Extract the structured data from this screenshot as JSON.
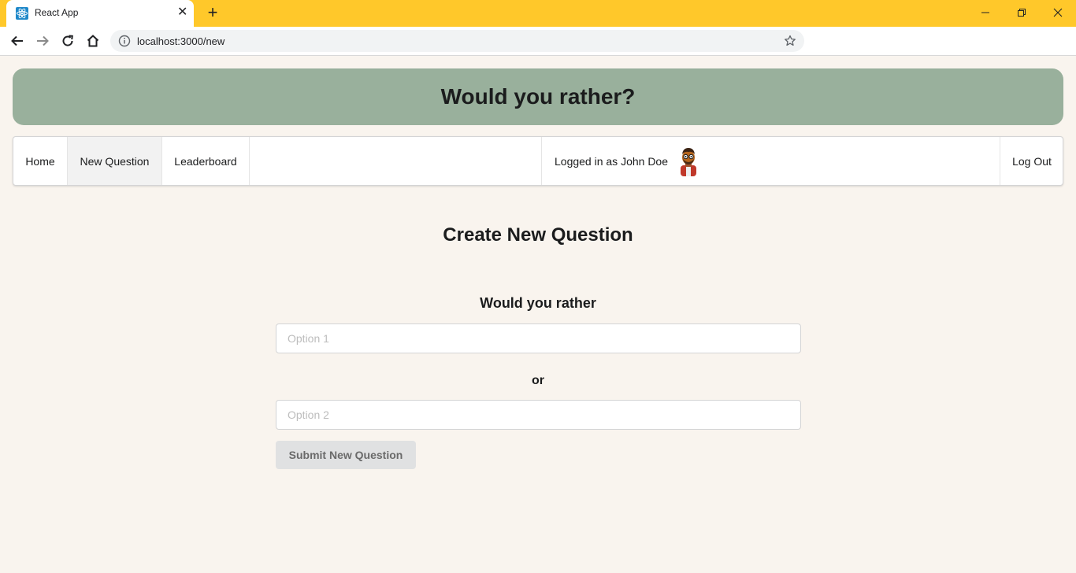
{
  "browser": {
    "tab_title": "React App",
    "url": "localhost:3000/new"
  },
  "app": {
    "title": "Would you rather?"
  },
  "nav": {
    "home": "Home",
    "new_question": "New Question",
    "leaderboard": "Leaderboard",
    "logged_in_text": "Logged in as John Doe",
    "logout": "Log Out",
    "active_item": "New Question"
  },
  "form": {
    "heading": "Create New Question",
    "prompt": "Would you rather",
    "option1_placeholder": "Option 1",
    "option1_value": "",
    "or_label": "or",
    "option2_placeholder": "Option 2",
    "option2_value": "",
    "submit_label": "Submit New Question"
  },
  "colors": {
    "titlebar": "#ffc82a",
    "header_bg": "#99b09c",
    "page_bg": "#f9f4ee"
  }
}
